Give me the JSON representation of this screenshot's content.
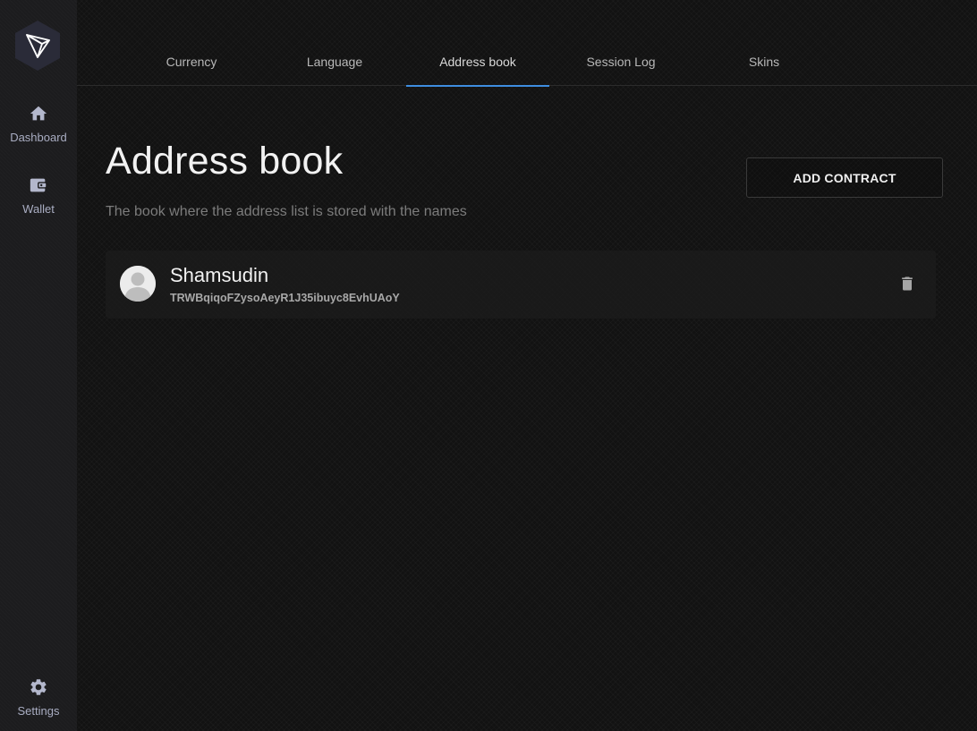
{
  "sidebar": {
    "logo_icon": "tron-logo-icon",
    "items": [
      {
        "label": "Dashboard",
        "icon": "home-icon"
      },
      {
        "label": "Wallet",
        "icon": "wallet-icon"
      },
      {
        "label": "Settings",
        "icon": "gear-icon"
      }
    ]
  },
  "tabs": [
    {
      "label": "Currency"
    },
    {
      "label": "Language"
    },
    {
      "label": "Address book",
      "active": true
    },
    {
      "label": "Session Log"
    },
    {
      "label": "Skins"
    }
  ],
  "page": {
    "title": "Address book",
    "subtitle": "The book where the address list is stored with the names",
    "add_button_label": "ADD CONTRACT"
  },
  "contacts": [
    {
      "name": "Shamsudin",
      "address": "TRWBqiqoFZysoAeyR1J35ibuyc8EvhUAoY",
      "avatar_icon": "user-avatar-icon",
      "delete_icon": "trash-icon"
    }
  ],
  "colors": {
    "accent": "#3e8de0",
    "sidebar_bg": "#1c1c1e",
    "main_bg": "#121212",
    "sidebar_text": "#a9adc2"
  }
}
